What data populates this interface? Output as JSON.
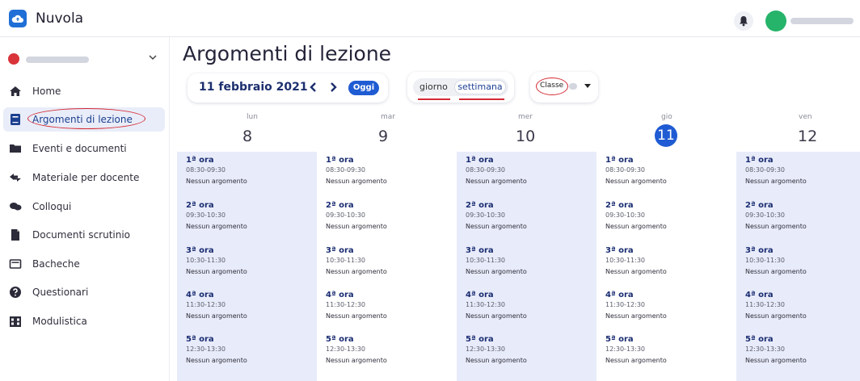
{
  "app": {
    "title": "Nuvola"
  },
  "sidebar": {
    "items": [
      {
        "label": "Home",
        "icon": "home-icon"
      },
      {
        "label": "Argomenti di lezione",
        "icon": "book-icon",
        "active": true
      },
      {
        "label": "Eventi e documenti",
        "icon": "folder-icon"
      },
      {
        "label": "Materiale per docente",
        "icon": "share-icon"
      },
      {
        "label": "Colloqui",
        "icon": "chat-icon"
      },
      {
        "label": "Documenti scrutinio",
        "icon": "document-icon"
      },
      {
        "label": "Bacheche",
        "icon": "board-icon"
      },
      {
        "label": "Questionari",
        "icon": "question-icon"
      },
      {
        "label": "Modulistica",
        "icon": "building-icon"
      }
    ]
  },
  "main": {
    "title": "Argomenti di lezione",
    "date_label": "11 febbraio 2021",
    "today_button": "Oggi",
    "view_day": "giorno",
    "view_week": "settimana",
    "class_label": "Classe"
  },
  "calendar": {
    "days": [
      {
        "name": "lun",
        "number": "8"
      },
      {
        "name": "mar",
        "number": "9"
      },
      {
        "name": "mer",
        "number": "10"
      },
      {
        "name": "gio",
        "number": "11",
        "today": true
      },
      {
        "name": "ven",
        "number": "12"
      }
    ],
    "slots": [
      {
        "hour": "1ª ora",
        "time": "08:30-09:30"
      },
      {
        "hour": "2ª ora",
        "time": "09:30-10:30"
      },
      {
        "hour": "3ª ora",
        "time": "10:30-11:30"
      },
      {
        "hour": "4ª ora",
        "time": "11:30-12:30"
      },
      {
        "hour": "5ª ora",
        "time": "12:30-13:30"
      }
    ],
    "empty_text": "Nessun argomento"
  },
  "colors": {
    "accent": "#1f5bd3",
    "annotation": "#d42a34",
    "column_shade": "#e8ebf9"
  }
}
